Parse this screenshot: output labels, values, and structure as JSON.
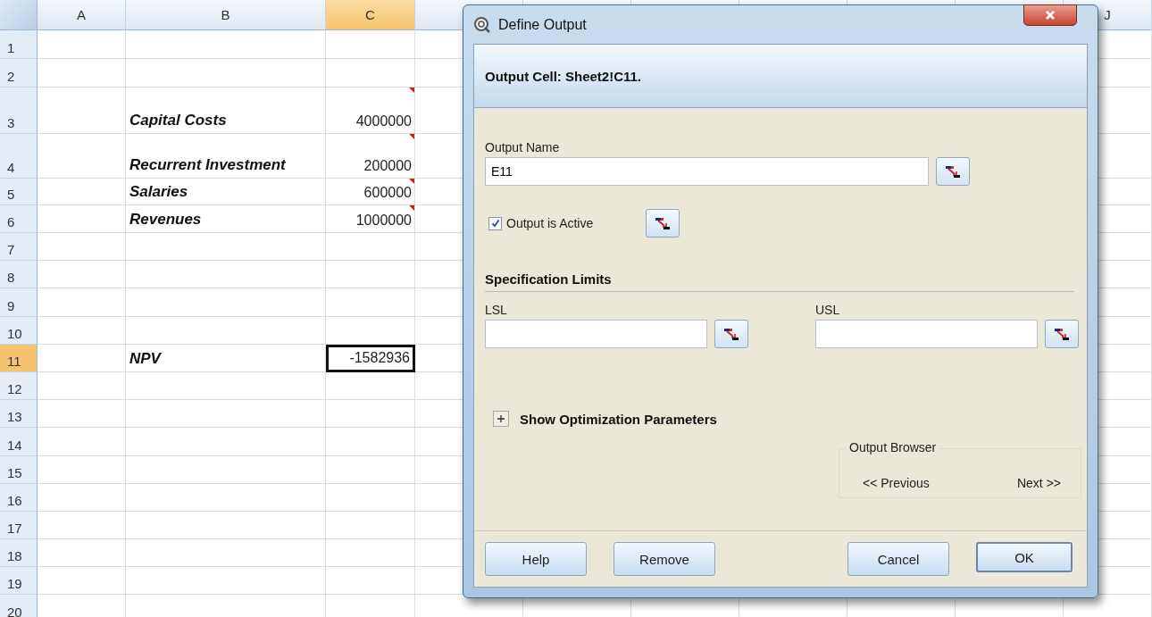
{
  "sheet": {
    "columns": [
      {
        "letter": "A",
        "selected": false
      },
      {
        "letter": "B",
        "selected": false
      },
      {
        "letter": "C",
        "selected": true
      },
      {
        "letter": "J",
        "selected": false
      }
    ],
    "rows": [
      {
        "number": "1",
        "selected": false
      },
      {
        "number": "2",
        "selected": false
      },
      {
        "number": "3",
        "selected": false,
        "column_b": "Capital Costs",
        "column_c": "4000000",
        "comment": true
      },
      {
        "number": "4",
        "selected": false,
        "column_b": "Recurrent Investment",
        "column_c": "200000",
        "comment": true
      },
      {
        "number": "5",
        "selected": false,
        "column_b": "Salaries",
        "column_c": "600000",
        "comment": true
      },
      {
        "number": "6",
        "selected": false,
        "column_b": "Revenues",
        "column_c": "1000000",
        "comment": true
      },
      {
        "number": "7",
        "selected": false
      },
      {
        "number": "8",
        "selected": false
      },
      {
        "number": "9",
        "selected": false
      },
      {
        "number": "10",
        "selected": false
      },
      {
        "number": "11",
        "selected": true,
        "column_b": "NPV",
        "column_c": "-1582936",
        "comment": false
      },
      {
        "number": "12",
        "selected": false
      },
      {
        "number": "13",
        "selected": false
      },
      {
        "number": "14",
        "selected": false
      },
      {
        "number": "15",
        "selected": false
      },
      {
        "number": "16",
        "selected": false
      },
      {
        "number": "17",
        "selected": false
      },
      {
        "number": "18",
        "selected": false
      },
      {
        "number": "19",
        "selected": false
      },
      {
        "number": "20",
        "selected": false
      }
    ]
  },
  "dialog": {
    "title": "Define Output",
    "header": "Output Cell: Sheet2!C11.",
    "output_name": {
      "label": "Output Name",
      "value": "E11"
    },
    "active": {
      "label": "Output is Active",
      "checked": true
    },
    "spec_section": "Specification Limits",
    "lsl": {
      "label": "LSL"
    },
    "usl": {
      "label": "USL"
    },
    "optimization": {
      "label": "Show Optimization Parameters",
      "expanded": false
    },
    "browser": {
      "title": "Output Browser",
      "previous": "<< Previous",
      "next": "Next >>"
    },
    "buttons": [
      {
        "label": "Help",
        "default": false
      },
      {
        "label": "Remove",
        "default": false
      },
      {
        "label": "Cancel",
        "default": false
      },
      {
        "label": "OK",
        "default": true
      }
    ]
  }
}
